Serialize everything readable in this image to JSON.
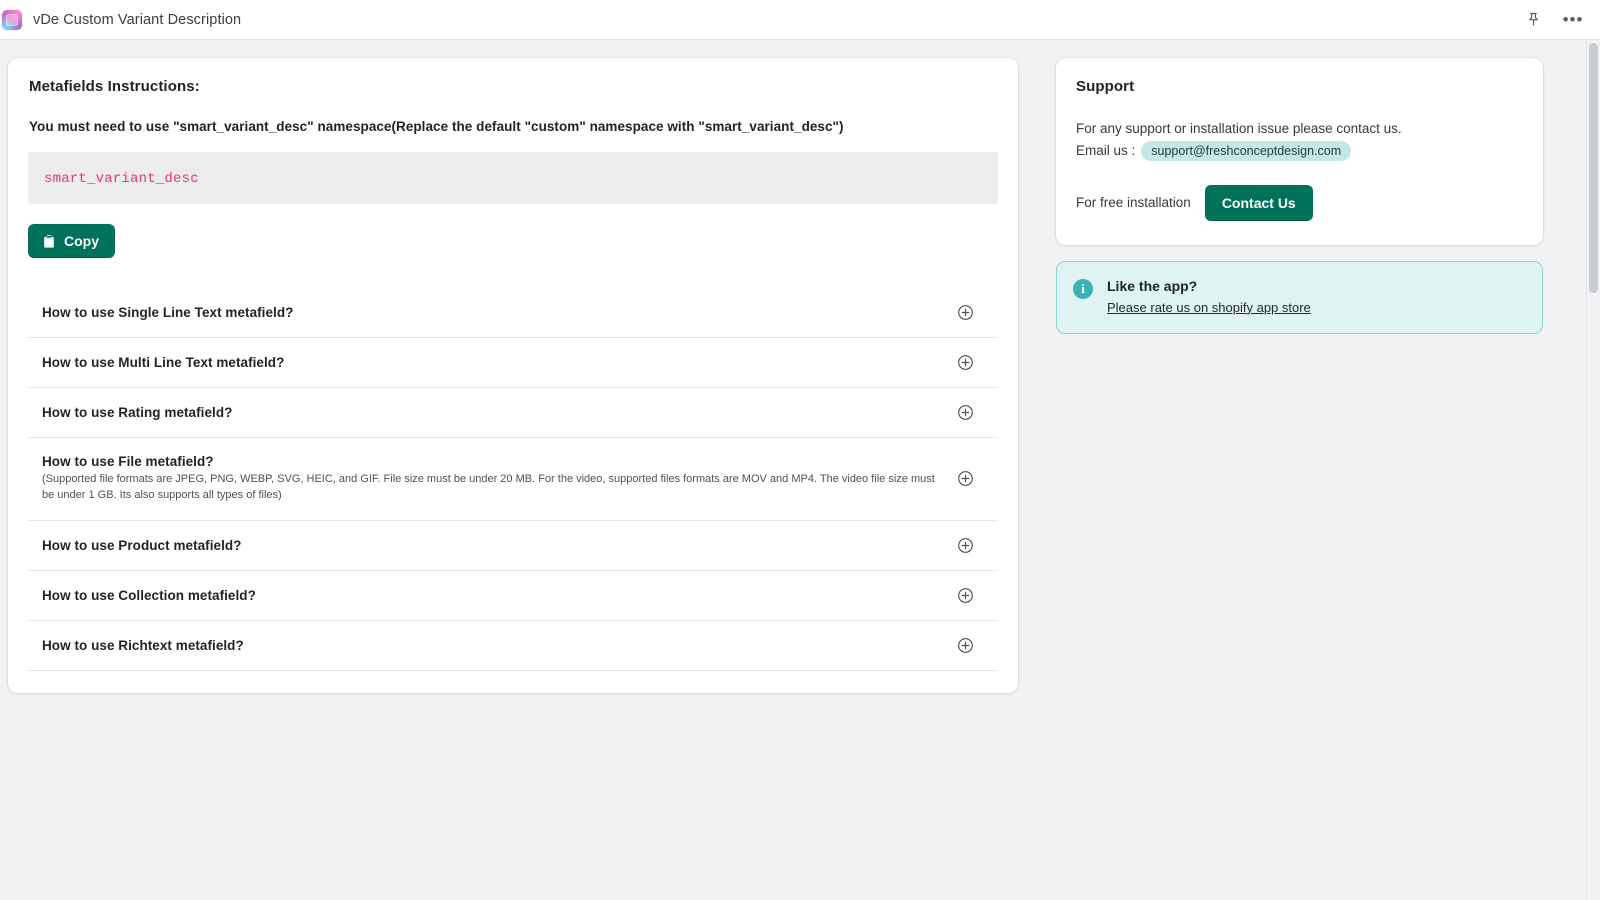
{
  "topbar": {
    "app_title": "vDe Custom Variant Description",
    "app_icon": "app-gradient-icon",
    "pin_icon": "pin-icon",
    "more_icon": "more-options-icon",
    "accent_green": "#00725a",
    "accent_teal": "#3cb1b8"
  },
  "main": {
    "heading": "Metafields Instructions:",
    "namespace_note": "You must need to use \"smart_variant_desc\" namespace(Replace the default \"custom\" namespace with \"smart_variant_desc\")",
    "code_snippet": "smart_variant_desc",
    "copy_label": "Copy",
    "copy_icon": "clipboard-icon",
    "faq": [
      {
        "question": "How to use Single Line Text metafield?",
        "description": "",
        "toggle_icon": "plus-circle-icon"
      },
      {
        "question": "How to use Multi Line Text metafield?",
        "description": "",
        "toggle_icon": "plus-circle-icon"
      },
      {
        "question": "How to use Rating metafield?",
        "description": "",
        "toggle_icon": "plus-circle-icon"
      },
      {
        "question": "How to use File metafield?",
        "description": "(Supported file formats are JPEG, PNG, WEBP, SVG, HEIC, and GIF. File size must be under 20 MB. For the video, supported files formats are MOV and MP4. The video file size must be under 1 GB. Its also supports all types of files)",
        "toggle_icon": "plus-circle-icon"
      },
      {
        "question": "How to use Product metafield?",
        "description": "",
        "toggle_icon": "plus-circle-icon"
      },
      {
        "question": "How to use Collection metafield?",
        "description": "",
        "toggle_icon": "plus-circle-icon"
      },
      {
        "question": "How to use Richtext metafield?",
        "description": "",
        "toggle_icon": "plus-circle-icon"
      }
    ]
  },
  "support": {
    "title": "Support",
    "intro": "For any support or installation issue please contact us.",
    "email_label": "Email us :",
    "email": "support@freshconceptdesign.com",
    "install_label": "For free installation",
    "contact_label": "Contact Us"
  },
  "rate_banner": {
    "info_icon": "info-circle-icon",
    "info_glyph": "i",
    "title": "Like the app?",
    "link": "Please rate us on shopify app store"
  }
}
